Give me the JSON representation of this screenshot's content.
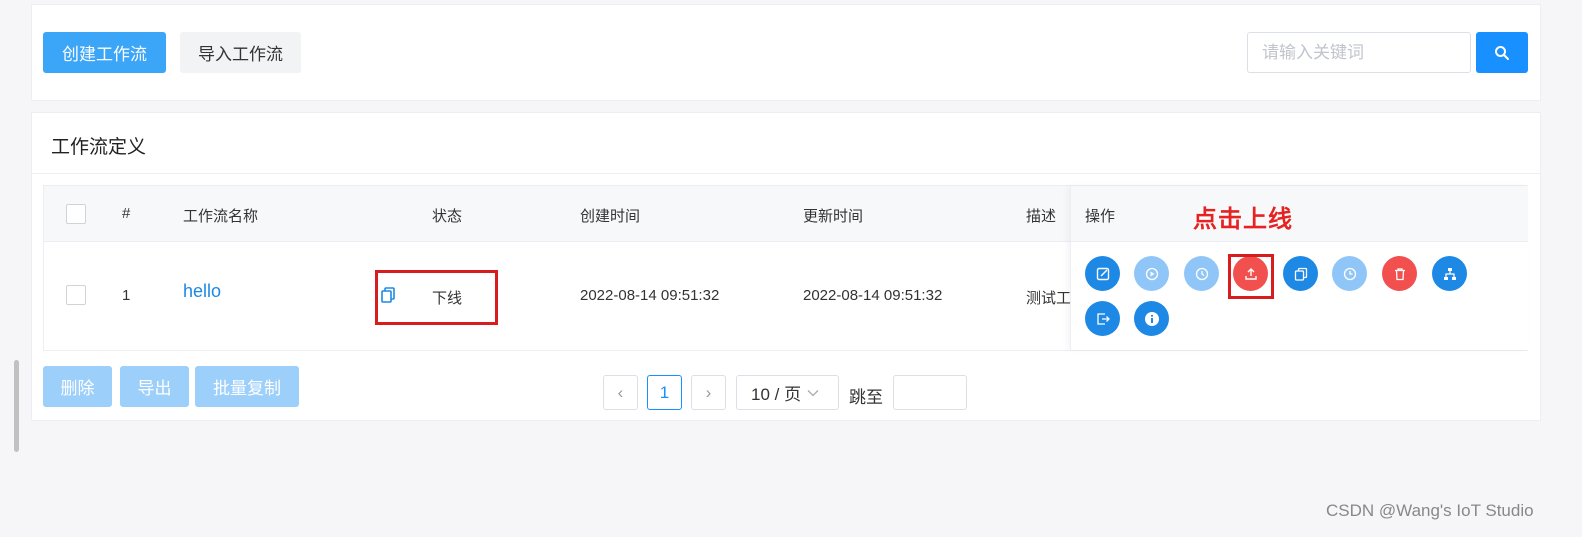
{
  "toolbar": {
    "create_label": "创建工作流",
    "import_label": "导入工作流",
    "search_placeholder": "请输入关键词"
  },
  "card": {
    "title": "工作流定义"
  },
  "table": {
    "headers": [
      "#",
      "工作流名称",
      "状态",
      "创建时间",
      "更新时间",
      "描述",
      "操作"
    ],
    "rows": [
      {
        "index": "1",
        "name": "hello",
        "status": "下线",
        "created": "2022-08-14 09:51:32",
        "updated": "2022-08-14 09:51:32",
        "description": "测试工"
      }
    ]
  },
  "ops_icons": [
    "edit-icon",
    "run-icon",
    "timing-icon",
    "online-icon",
    "copy-icon",
    "timing-manage-icon",
    "delete-icon",
    "tree-icon",
    "export-icon",
    "info-icon"
  ],
  "annotation": {
    "text": "点击上线",
    "color": "#e52323"
  },
  "bulk": {
    "delete_label": "删除",
    "export_label": "导出",
    "batch_copy_label": "批量复制"
  },
  "pagination": {
    "prev": "‹",
    "current_page": "1",
    "next": "›",
    "page_size": "10 / 页",
    "jump_label": "跳至"
  },
  "watermark": "CSDN @Wang's IoT Studio",
  "colors": {
    "primary": "#1890ff",
    "danger": "#f2504f",
    "disabled": "#9ccffa"
  }
}
